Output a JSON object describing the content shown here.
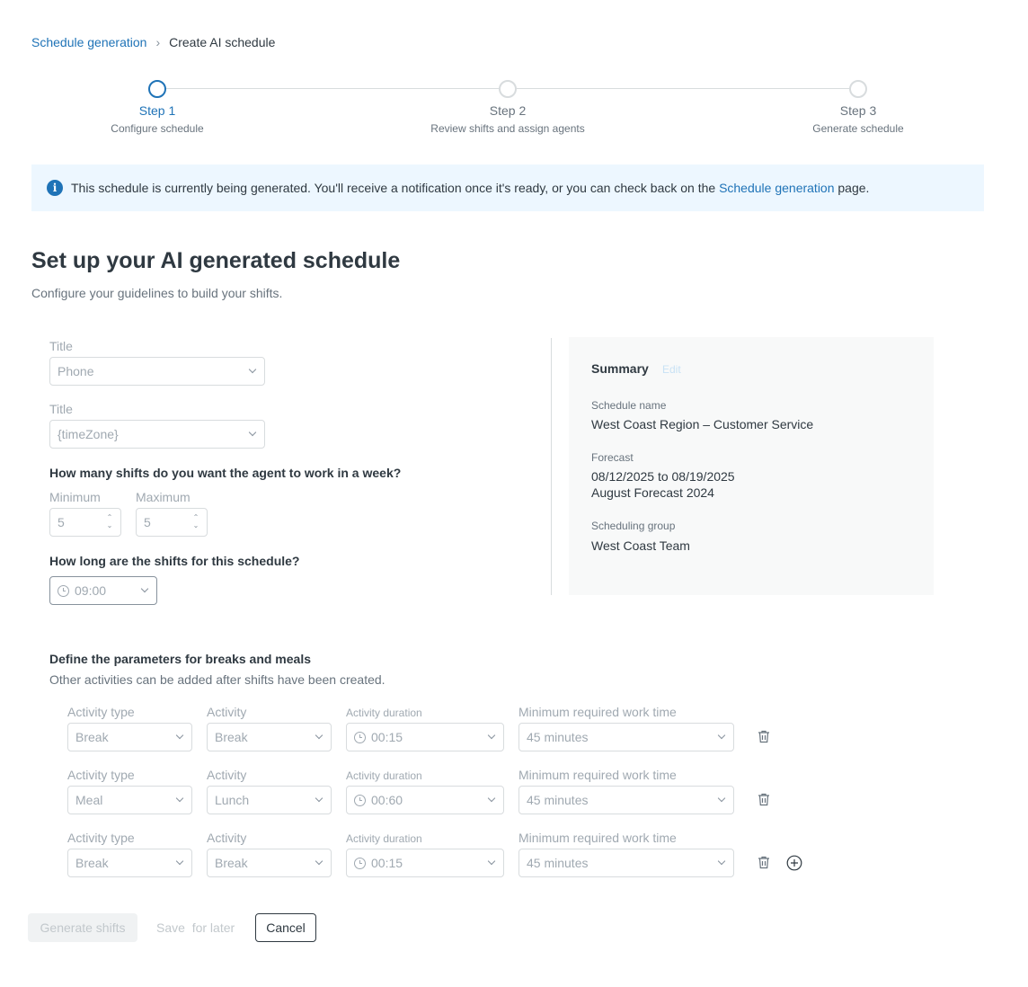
{
  "breadcrumb": {
    "parent": "Schedule generation",
    "separator": ">",
    "current": "Create AI schedule"
  },
  "stepper": {
    "steps": [
      {
        "label": "Step 1",
        "sub": "Configure schedule",
        "active": true
      },
      {
        "label": "Step 2",
        "sub": "Review shifts and assign agents",
        "active": false
      },
      {
        "label": "Step 3",
        "sub": "Generate schedule",
        "active": false
      }
    ]
  },
  "alert": {
    "icon": "info-icon",
    "text_before": "This schedule is currently being generated. You'll receive a notification once it's ready, or you can check back on the ",
    "link": "Schedule generation",
    "text_after": " page."
  },
  "page": {
    "title": "Set up your AI generated schedule",
    "subtitle": "Configure your guidelines to build your shifts."
  },
  "form": {
    "field1_label": "Title",
    "field1_value": "Phone",
    "field2_label": "Title",
    "field2_value": "{timeZone}",
    "shifts_question": "How many shifts do you want the agent to work in a week?",
    "min_label": "Minimum",
    "min_value": "5",
    "max_label": "Maximum",
    "max_value": "5",
    "length_question": "How long are the shifts for this schedule?",
    "length_value": "09:00"
  },
  "summary": {
    "title": "Summary",
    "edit": "Edit",
    "schedule_name_label": "Schedule name",
    "schedule_name_value": "West Coast Region – Customer Service",
    "forecast_label": "Forecast",
    "forecast_dates": "08/12/2025 to 08/19/2025",
    "forecast_name": "August Forecast 2024",
    "group_label": "Scheduling group",
    "group_value": "West Coast Team"
  },
  "breaks": {
    "title": "Define the parameters for breaks and meals",
    "subtitle": "Other activities can be added after shifts have been created.",
    "col_type": "Activity type",
    "col_activity": "Activity",
    "col_duration": "Activity duration",
    "col_min_work": "Minimum required work time",
    "rows": [
      {
        "type": "Break",
        "activity": "Break",
        "duration": "00:15",
        "min_work": "45 minutes"
      },
      {
        "type": "Meal",
        "activity": "Lunch",
        "duration": "00:60",
        "min_work": "45 minutes"
      },
      {
        "type": "Break",
        "activity": "Break",
        "duration": "00:15",
        "min_work": "45 minutes"
      }
    ]
  },
  "footer": {
    "generate": "Generate shifts",
    "save": "Save  for later",
    "cancel": "Cancel"
  }
}
